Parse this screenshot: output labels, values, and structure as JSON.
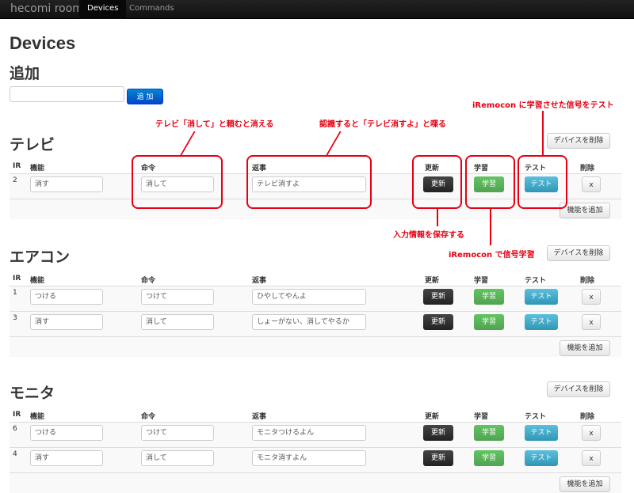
{
  "nav": {
    "brand": "hecomi room",
    "items": [
      "Devices",
      "Commands"
    ]
  },
  "page": {
    "title": "Devices",
    "add_heading": "追加",
    "add_button": "追 加",
    "add_input_value": ""
  },
  "headers": {
    "ir": "IR",
    "function": "機能",
    "command": "命令",
    "reply": "返事",
    "update": "更新",
    "learn": "学習",
    "test": "テスト",
    "delete": "削除"
  },
  "buttons": {
    "update": "更新",
    "learn": "学習",
    "test": "テスト",
    "delete": "x",
    "delete_device": "デバイスを削除",
    "add_function": "機能を追加"
  },
  "colors": {
    "update": "#222222",
    "learn": "#51a351",
    "test": "#2f96b4",
    "annotation": "#e60012",
    "primary": "#0044cc"
  },
  "devices": [
    {
      "name": "テレビ",
      "rows": [
        {
          "ir": "2",
          "function": "消す",
          "command": "消して",
          "reply": "テレビ消すよ"
        }
      ]
    },
    {
      "name": "エアコン",
      "rows": [
        {
          "ir": "1",
          "function": "つける",
          "command": "つけて",
          "reply": "ひやしてやんよ"
        },
        {
          "ir": "3",
          "function": "消す",
          "command": "消して",
          "reply": "しょーがない、消してやるか"
        }
      ]
    },
    {
      "name": "モニタ",
      "rows": [
        {
          "ir": "6",
          "function": "つける",
          "command": "つけて",
          "reply": "モニタつけるよん"
        },
        {
          "ir": "4",
          "function": "消す",
          "command": "消して",
          "reply": "モニタ消すよん"
        }
      ]
    }
  ],
  "annotations": {
    "command": "テレビ「消して」と頼むと消える",
    "reply": "認識すると「テレビ消すよ」と喋る",
    "test": "iRemocon に学習させた信号をテスト",
    "update": "入力情報を保存する",
    "learn": "iRemocon で信号学習"
  }
}
